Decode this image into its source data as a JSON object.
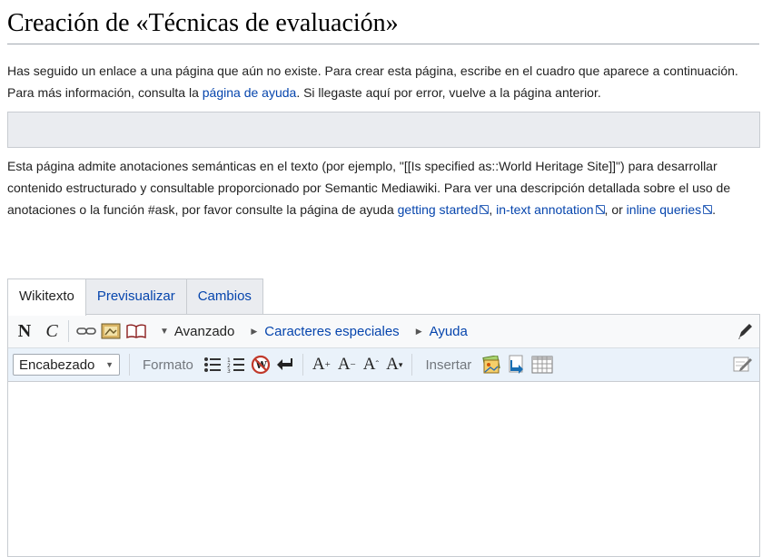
{
  "title": "Creación de «Técnicas de evaluación»",
  "intro": {
    "text1": "Has seguido un enlace a una página que aún no existe. Para crear esta página, escribe en el cuadro que aparece a continuación. Para más información, consulta la ",
    "help_link": "página de ayuda",
    "text2": ". Si llegaste aquí por error, vuelve a la página anterior."
  },
  "semantic": {
    "text1": "Esta página admite anotaciones semánticas en el texto (por ejemplo, \"[[Is specified as::World Heritage Site]]\") para desarrollar contenido estructurado y consultable proporcionado por Semantic Mediawiki. Para ver una descripción detallada sobre el uso de anotaciones o la función #ask, por favor consulte la página de ayuda ",
    "link1": "getting started",
    "sep1": ", ",
    "link2": "in-text annotation",
    "sep2": ", or ",
    "link3": "inline queries",
    "end": "."
  },
  "tabs": [
    {
      "label": "Wikitexto",
      "active": true
    },
    {
      "label": "Previsualizar",
      "active": false
    },
    {
      "label": "Cambios",
      "active": false
    }
  ],
  "toolbar": {
    "bold": "N",
    "italic": "C",
    "advanced": "Avanzado",
    "special_chars": "Caracteres especiales",
    "help": "Ayuda",
    "heading_select": "Encabezado",
    "format_label": "Formato",
    "insert_label": "Insertar",
    "big_a": "A",
    "icons": [
      "link-icon",
      "image-icon",
      "book-icon",
      "pencil-icon",
      "bulleted-list-icon",
      "numbered-list-icon",
      "nowiki-icon",
      "newline-icon",
      "insert-image-icon",
      "redirect-icon",
      "table-icon",
      "signature-icon"
    ]
  },
  "colors": {
    "link": "#0645ad",
    "toolbar_bg": "#eaf2fa",
    "border": "#c8ccd1"
  }
}
